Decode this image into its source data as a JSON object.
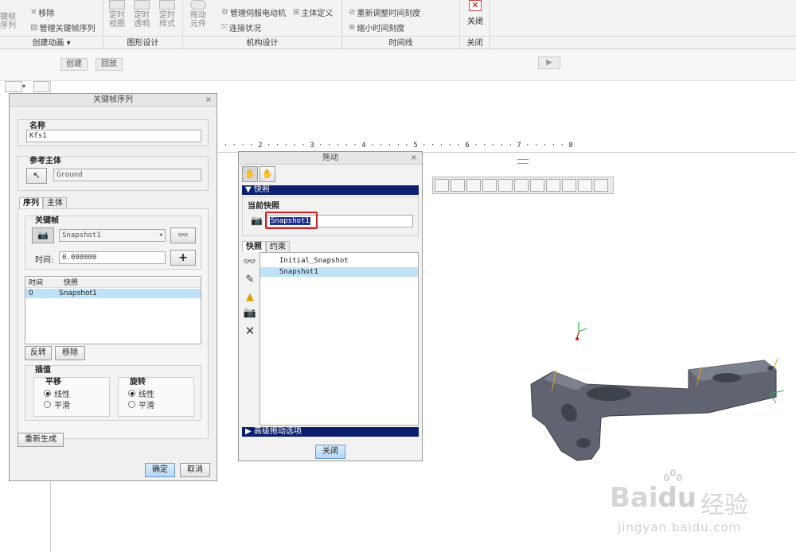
{
  "ribbon": {
    "left_big_label": "键帧\n序列",
    "remove": "移除",
    "manage_keyframe_seq": "管理关键帧序列",
    "group_animation": "创建动画",
    "chevron": "▾",
    "btn_fix_view": "定时\n视图",
    "btn_fix_trans": "定时\n透明",
    "btn_fix_style": "定时\n样式",
    "group_graphics": "图形设计",
    "btn_drag": "拖动\n元件",
    "manage_servo": "管理伺服电动机",
    "body_define": "主体定义",
    "connection_status": "连接状况",
    "group_mechanism": "机构设计",
    "readjust_timescale": "重新调整时间刻度",
    "shrink_timescale": "缩小时间刻度",
    "group_timeline": "时间线",
    "close_label": "关闭",
    "group_close": "关闭"
  },
  "toolbar2": {
    "create": "创建",
    "playback": "回放",
    "play": "▶"
  },
  "ruler_text": "·  ·  ·  ·  ·  2  ·  ·  ·  ·  ·  3  ·  ·  ·  ·  ·  4  ·  ·  ·  ·  ·  5  ·  ·  ·  ·  ·  6  ·  ·  ·  ·  ·  7  ·  ·  ·  ·  ·  8",
  "keyframe_dialog": {
    "title": "关键帧序列",
    "close_x": "×",
    "name_label": "名称",
    "name_value": "Kfs1",
    "ref_body_label": "参考主体",
    "ref_body_value": "Ground",
    "tabs": [
      "序列",
      "主体"
    ],
    "keyframe_label": "关键帧",
    "keyframe_value": "Snapshot1",
    "time_label": "时间:",
    "time_value": "0.000000",
    "list_headers": [
      "时间",
      "快照"
    ],
    "list_rows": [
      {
        "time": "0",
        "snap": "Snapshot1"
      }
    ],
    "reverse": "反转",
    "remove": "移除",
    "interp_label": "插值",
    "translate_label": "平移",
    "rotate_label": "旋转",
    "linear": "线性",
    "smooth": "平滑",
    "regenerate": "重新生成",
    "ok": "确定",
    "cancel": "取消"
  },
  "drag_dialog": {
    "title": "拖动",
    "close_x": "×",
    "snapshot_section": "快照",
    "current_snapshot_label": "当前快照",
    "current_snapshot_value": "Snapshot1",
    "tabs": [
      "快照",
      "约束"
    ],
    "snapshots": [
      "Initial_Snapshot",
      "Snapshot1"
    ],
    "advanced": "高级拖动选项",
    "close_btn": "关闭"
  },
  "watermark": {
    "brand": "Bai",
    "brand2": "du",
    "cn": "经验",
    "url": "jingyan.baidu.com"
  },
  "colors": {
    "accent_blue": "#0c1f6e",
    "selection": "#bfe2f7",
    "highlight_red": "#d32020",
    "model_gray": "#5f6470"
  }
}
